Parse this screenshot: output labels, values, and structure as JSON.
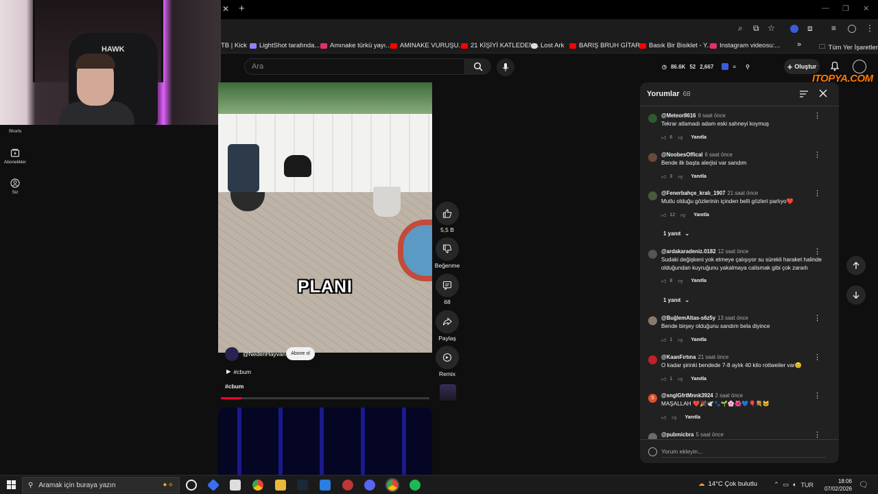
{
  "browser": {
    "bookmarks": [
      {
        "label": "TB | Kick",
        "color": "#53fc18"
      },
      {
        "label": "LightShot tarafında...",
        "color": "#9b7bff"
      },
      {
        "label": "Amınake türkü yayı...",
        "color": "#e1306c"
      },
      {
        "label": "AMINAKE VURUŞU...",
        "color": "#ff0000"
      },
      {
        "label": "21 KİŞİYİ KATLEDEN...",
        "color": "#ff0000"
      },
      {
        "label": "Lost Ark",
        "color": "#dddddd"
      },
      {
        "label": "BARIŞ BRUH GİTAR...",
        "color": "#ff0000"
      },
      {
        "label": "Basık Bir Bisiklet - Y...",
        "color": "#ff0000"
      },
      {
        "label": "Instagram videosu:...",
        "color": "#e1306c"
      }
    ],
    "all_bookmarks": "Tüm Yer İşaretleri"
  },
  "sidebar": {
    "items": [
      {
        "label": "Shorts",
        "icon": "shorts-icon"
      },
      {
        "label": "Abonelikler",
        "icon": "subscriptions-icon"
      },
      {
        "label": "Siz",
        "icon": "you-icon"
      }
    ]
  },
  "header": {
    "search_placeholder": "Ara",
    "stats": {
      "views": "86.6K",
      "likes": "52",
      "other": "2,667"
    },
    "create_label": "Oluştur",
    "watermark": "ITOPYA.COM"
  },
  "video": {
    "caption": "PLANI",
    "channel": "@NedenHayvan",
    "subscribe": "Abone ol",
    "song": "#cbum",
    "hashtag": "#cbum",
    "progress_fraction": 0.1
  },
  "actions": {
    "like_count": "5,5 B",
    "dislike_label": "Beğenme",
    "comment_count": "68",
    "share_label": "Paylaş",
    "remix_label": "Remix"
  },
  "comments": {
    "title": "Yorumlar",
    "count": "68",
    "reply_label": "Yanıtla",
    "add_placeholder": "Yorum ekleyin...",
    "items": [
      {
        "user": "@Meteor8616",
        "time": "9 saat önce",
        "text": "Tekrar atlamadı adam eski sahneyi koymuş",
        "likes": "6",
        "avatar_color": "#2e5a2e"
      },
      {
        "user": "@NoobesOffical",
        "time": "6 saat önce",
        "text": "Bende ilk başta alerjisi var sandım",
        "likes": "3",
        "avatar_color": "#6a4a3a"
      },
      {
        "user": "@Fenerbahçe_kralı_1907",
        "time": "21 saat önce",
        "text": "Mutlu olduğu gözlerinin içinden belli gözleri parlıyo❤️",
        "likes": "12",
        "replies": "1 yanıt",
        "avatar_color": "#4a5a3a"
      },
      {
        "user": "@ardakaradeniz.0182",
        "time": "12 saat önce",
        "text": "Sudaki değişkeni yok etmeye çalışıyor su sürekli haraket halinde olduğundan kuyruğunu yakalmaya calismak gibi çok zararlı",
        "likes": "8",
        "replies": "1 yanıt",
        "avatar_color": "#555555"
      },
      {
        "user": "@BuğlemAltas-s6z5y",
        "time": "13 saat önce",
        "text": "Bende birşey olduğunu sandım bela diyince",
        "likes": "1",
        "avatar_color": "#8a7a6a"
      },
      {
        "user": "@KaanFırtına",
        "time": "21 saat önce",
        "text": "O kadar şirinki bendede 7-8 aylık 40 kilo rottweiler var😊",
        "likes": "1",
        "avatar_color": "#c0202a"
      },
      {
        "user": "@snglGfrtMnnk3924",
        "time": "2 saat önce",
        "text": "MAŞALLAH ❤️🎉🕊️🐾🌱🌸🌺💙🎈💐🐱",
        "likes": "",
        "avatar_color": "#e0502a",
        "avatar_letter": "S"
      },
      {
        "user": "@pubmicbra",
        "time": "5 saat önce",
        "text": "",
        "likes": "",
        "avatar_color": "#6a6a6a"
      }
    ]
  },
  "taskbar": {
    "search_placeholder": "Aramak için buraya yazın",
    "weather": "14°C  Çok bulutlu",
    "lang": "TUR",
    "time": "18:06",
    "date": "07/02/2026"
  }
}
